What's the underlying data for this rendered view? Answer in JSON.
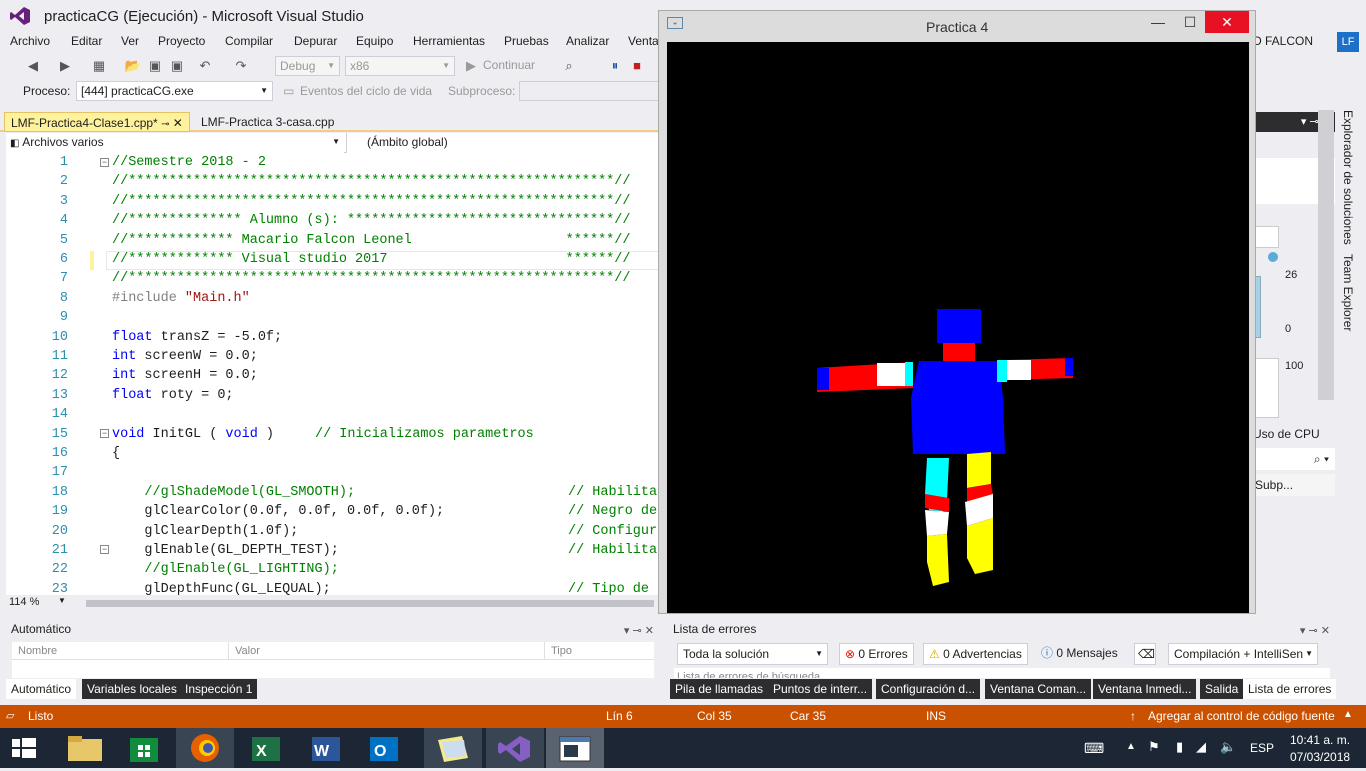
{
  "window": {
    "title": "practicaCG (Ejecución) - Microsoft Visual Studio"
  },
  "menu": [
    "Archivo",
    "Editar",
    "Ver",
    "Proyecto",
    "Compilar",
    "Depurar",
    "Equipo",
    "Herramientas",
    "Pruebas",
    "Analizar",
    "Venta"
  ],
  "user": {
    "name": "IO FALCON",
    "initials": "LF"
  },
  "toolbar": {
    "config": "Debug",
    "platform": "x86",
    "continue": "Continuar"
  },
  "process": {
    "label": "Proceso:",
    "value": "[444] practicaCG.exe",
    "lifecycle": "Eventos del ciclo de vida",
    "thread": "Subproceso:"
  },
  "tabs": [
    {
      "label": "LMF-Practica4-Clase1.cpp*"
    },
    {
      "label": "LMF-Practica 3-casa.cpp"
    }
  ],
  "nav": {
    "files": "Archivos varios",
    "scope": "(Ámbito global)"
  },
  "code": [
    {
      "n": "1",
      "t": "//Semestre 2018 - 2",
      "c": "cm"
    },
    {
      "n": "2",
      "t": "//************************************************************//",
      "c": "cm"
    },
    {
      "n": "3",
      "t": "//************************************************************//",
      "c": "cm"
    },
    {
      "n": "4",
      "t": "//************** Alumno (s): *********************************//",
      "c": "cm"
    },
    {
      "n": "5",
      "t": "//************* Macario Falcon Leonel                   ******//",
      "c": "cm"
    },
    {
      "n": "6",
      "t": "//************* Visual studio 2017                      ******//",
      "c": "cm"
    },
    {
      "n": "7",
      "t": "//************************************************************//",
      "c": "cm"
    },
    {
      "n": "8",
      "t": "#include ",
      "c": "pp",
      "s": "\"Main.h\""
    },
    {
      "n": "9",
      "t": "",
      "c": ""
    },
    {
      "n": "10",
      "k": "float",
      "t": " transZ = -5.0f;",
      "c": ""
    },
    {
      "n": "11",
      "k": "int",
      "t": " screenW = 0.0;",
      "c": ""
    },
    {
      "n": "12",
      "k": "int",
      "t": " screenH = 0.0;",
      "c": ""
    },
    {
      "n": "13",
      "k": "float",
      "t": " roty = 0;",
      "c": ""
    },
    {
      "n": "14",
      "t": "",
      "c": ""
    },
    {
      "n": "15",
      "k": "void",
      "t": " InitGL ( ",
      "k2": "void",
      "t2": " )     ",
      "cmt": "// Inicializamos parametros"
    },
    {
      "n": "16",
      "t": "{",
      "c": ""
    },
    {
      "n": "17",
      "t": "",
      "c": ""
    },
    {
      "n": "18",
      "t": "    //glShadeModel(GL_SMOOTH);",
      "c": "cm",
      "cmt": "// Habilita"
    },
    {
      "n": "19",
      "t": "    glClearColor(0.0f, 0.0f, 0.0f, 0.0f);",
      "c": "",
      "cmt": "// Negro de"
    },
    {
      "n": "20",
      "t": "    glClearDepth(1.0f);",
      "c": "",
      "cmt": "// Configur"
    },
    {
      "n": "21",
      "t": "    glEnable(GL_DEPTH_TEST);",
      "c": "",
      "cmt": "// Habilita"
    },
    {
      "n": "22",
      "t": "    //glEnable(GL_LIGHTING);",
      "c": "cm"
    },
    {
      "n": "23",
      "t": "    glDepthFunc(GL_LEQUAL);",
      "c": "",
      "cmt": "// Tipo de"
    }
  ],
  "zoom": "114 %",
  "autos": {
    "title": "Automático",
    "cols": [
      "Nombre",
      "Valor",
      "Tipo"
    ]
  },
  "bottomTabsLeft": [
    "Automático",
    "Variables locales",
    "Inspección 1"
  ],
  "errors": {
    "title": "Lista de errores",
    "scope": "Toda la solución",
    "errors": "0 Errores",
    "warnings": "0 Advertencias",
    "messages": "0 Mensajes",
    "build": "Compilación + IntelliSen",
    "search": "Lista de errores de búsqueda"
  },
  "bottomTabsRight": [
    "Pila de llamadas",
    "Puntos de interr...",
    "Configuración d...",
    "Ventana Coman...",
    "Ventana Inmedi...",
    "Salida",
    "Lista de errores"
  ],
  "rightStrip": [
    "Explorador de soluciones",
    "Team Explorer"
  ],
  "rightPanel": {
    "v1": "26",
    "v2": "0",
    "v3": "100",
    "cpu": "Uso de CPU",
    "subp": "Subp..."
  },
  "status": {
    "ready": "Listo",
    "line": "Lín 6",
    "col": "Col 35",
    "car": "Car 35",
    "ins": "INS",
    "source": "Agregar al control de código fuente"
  },
  "glwindow": {
    "title": "Practica 4"
  },
  "tray": {
    "lang": "ESP",
    "time": "10:41 a. m.",
    "date": "07/03/2018"
  },
  "colors": {
    "accent": "#ca5100",
    "vsPurple": "#68217a",
    "taskbar": "#1c2634"
  }
}
